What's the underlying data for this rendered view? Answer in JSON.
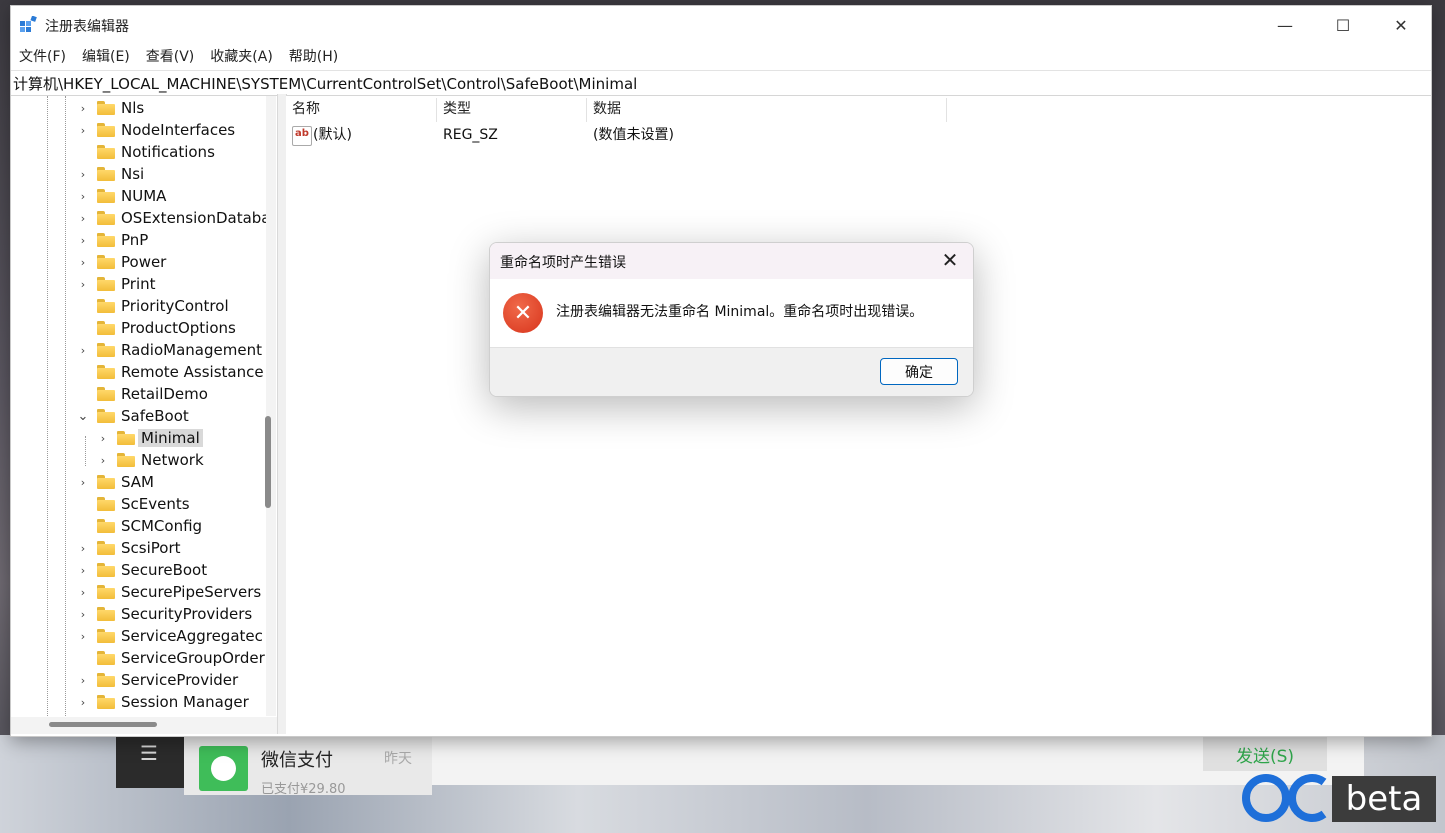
{
  "window": {
    "title": "注册表编辑器",
    "controls": {
      "minimize": "—",
      "maximize": "☐",
      "close": "✕"
    }
  },
  "menu": [
    "文件(F)",
    "编辑(E)",
    "查看(V)",
    "收藏夹(A)",
    "帮助(H)"
  ],
  "address": "计算机\\HKEY_LOCAL_MACHINE\\SYSTEM\\CurrentControlSet\\Control\\SafeBoot\\Minimal",
  "tree": {
    "items": [
      {
        "label": "Nls",
        "expand": "collapsed",
        "level": 0
      },
      {
        "label": "NodeInterfaces",
        "expand": "collapsed",
        "level": 0
      },
      {
        "label": "Notifications",
        "expand": "none",
        "level": 0
      },
      {
        "label": "Nsi",
        "expand": "collapsed",
        "level": 0
      },
      {
        "label": "NUMA",
        "expand": "collapsed",
        "level": 0
      },
      {
        "label": "OSExtensionDataba",
        "expand": "collapsed",
        "level": 0
      },
      {
        "label": "PnP",
        "expand": "collapsed",
        "level": 0
      },
      {
        "label": "Power",
        "expand": "collapsed",
        "level": 0
      },
      {
        "label": "Print",
        "expand": "collapsed",
        "level": 0
      },
      {
        "label": "PriorityControl",
        "expand": "none",
        "level": 0
      },
      {
        "label": "ProductOptions",
        "expand": "none",
        "level": 0
      },
      {
        "label": "RadioManagement",
        "expand": "collapsed",
        "level": 0
      },
      {
        "label": "Remote Assistance",
        "expand": "none",
        "level": 0
      },
      {
        "label": "RetailDemo",
        "expand": "none",
        "level": 0
      },
      {
        "label": "SafeBoot",
        "expand": "expanded",
        "level": 0
      },
      {
        "label": "Minimal",
        "expand": "collapsed",
        "level": 1,
        "selected": true
      },
      {
        "label": "Network",
        "expand": "collapsed",
        "level": 1
      },
      {
        "label": "SAM",
        "expand": "collapsed",
        "level": 0
      },
      {
        "label": "ScEvents",
        "expand": "none",
        "level": 0
      },
      {
        "label": "SCMConfig",
        "expand": "none",
        "level": 0
      },
      {
        "label": "ScsiPort",
        "expand": "collapsed",
        "level": 0
      },
      {
        "label": "SecureBoot",
        "expand": "collapsed",
        "level": 0
      },
      {
        "label": "SecurePipeServers",
        "expand": "collapsed",
        "level": 0
      },
      {
        "label": "SecurityProviders",
        "expand": "collapsed",
        "level": 0
      },
      {
        "label": "ServiceAggregatec",
        "expand": "collapsed",
        "level": 0
      },
      {
        "label": "ServiceGroupOrder",
        "expand": "none",
        "level": 0
      },
      {
        "label": "ServiceProvider",
        "expand": "collapsed",
        "level": 0
      },
      {
        "label": "Session Manager",
        "expand": "collapsed",
        "level": 0
      }
    ]
  },
  "list": {
    "columns": [
      "名称",
      "类型",
      "数据"
    ],
    "rows": [
      {
        "icon": "ab",
        "name": "(默认)",
        "type": "REG_SZ",
        "data": "(数值未设置)"
      }
    ]
  },
  "dialog": {
    "title": "重命名项时产生错误",
    "message": "注册表编辑器无法重命名 Minimal。重命名项时出现错误。",
    "ok_label": "确定",
    "close": "✕"
  },
  "background": {
    "chat_name": "微信支付",
    "chat_time": "昨天",
    "chat_preview": "已支付¥29.80",
    "send_label": "发送(S)",
    "menu_glyph": "☰",
    "logo_text": "beta"
  },
  "colors": {
    "accent": "#0067c0",
    "error": "#d8341c",
    "folder": "#f2bd3a",
    "wechat_green": "#3fbd59"
  }
}
